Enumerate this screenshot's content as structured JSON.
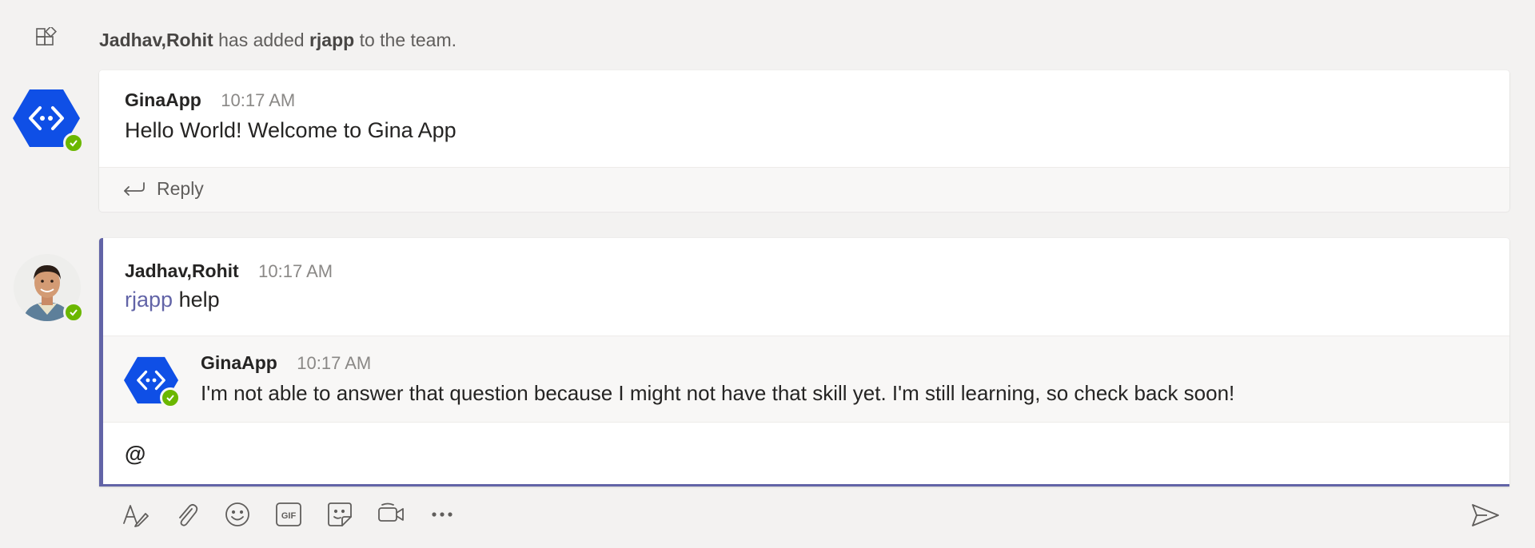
{
  "system_event": {
    "actor": "Jadhav,Rohit",
    "action": "has added",
    "target": "rjapp",
    "suffix": "to the team.",
    "icon": "team-add-icon"
  },
  "messages": [
    {
      "sender": "GinaApp",
      "time": "10:17 AM",
      "text": "Hello World! Welcome to Gina App",
      "avatar_icon": "bot-avatar-icon",
      "presence": "available"
    }
  ],
  "reply": {
    "label": "Reply",
    "icon": "reply-icon"
  },
  "thread": {
    "sender": "Jadhav,Rohit",
    "time": "10:17 AM",
    "mention": "rjapp",
    "text": "help",
    "presence": "available",
    "nested_reply": {
      "sender": "GinaApp",
      "time": "10:17 AM",
      "text": "I'm not able to answer that question because I might not have that skill yet. I'm still learning, so check back soon!"
    }
  },
  "compose": {
    "value": "@",
    "toolbar": [
      "format-icon",
      "attach-icon",
      "emoji-icon",
      "gif-icon",
      "sticker-icon",
      "meet-now-icon",
      "more-options-icon"
    ],
    "send_icon": "send-icon"
  },
  "colors": {
    "background": "#f3f2f1",
    "accent": "#6264a7",
    "bot_blue": "#0f4fe6",
    "presence_green": "#6bb700"
  }
}
